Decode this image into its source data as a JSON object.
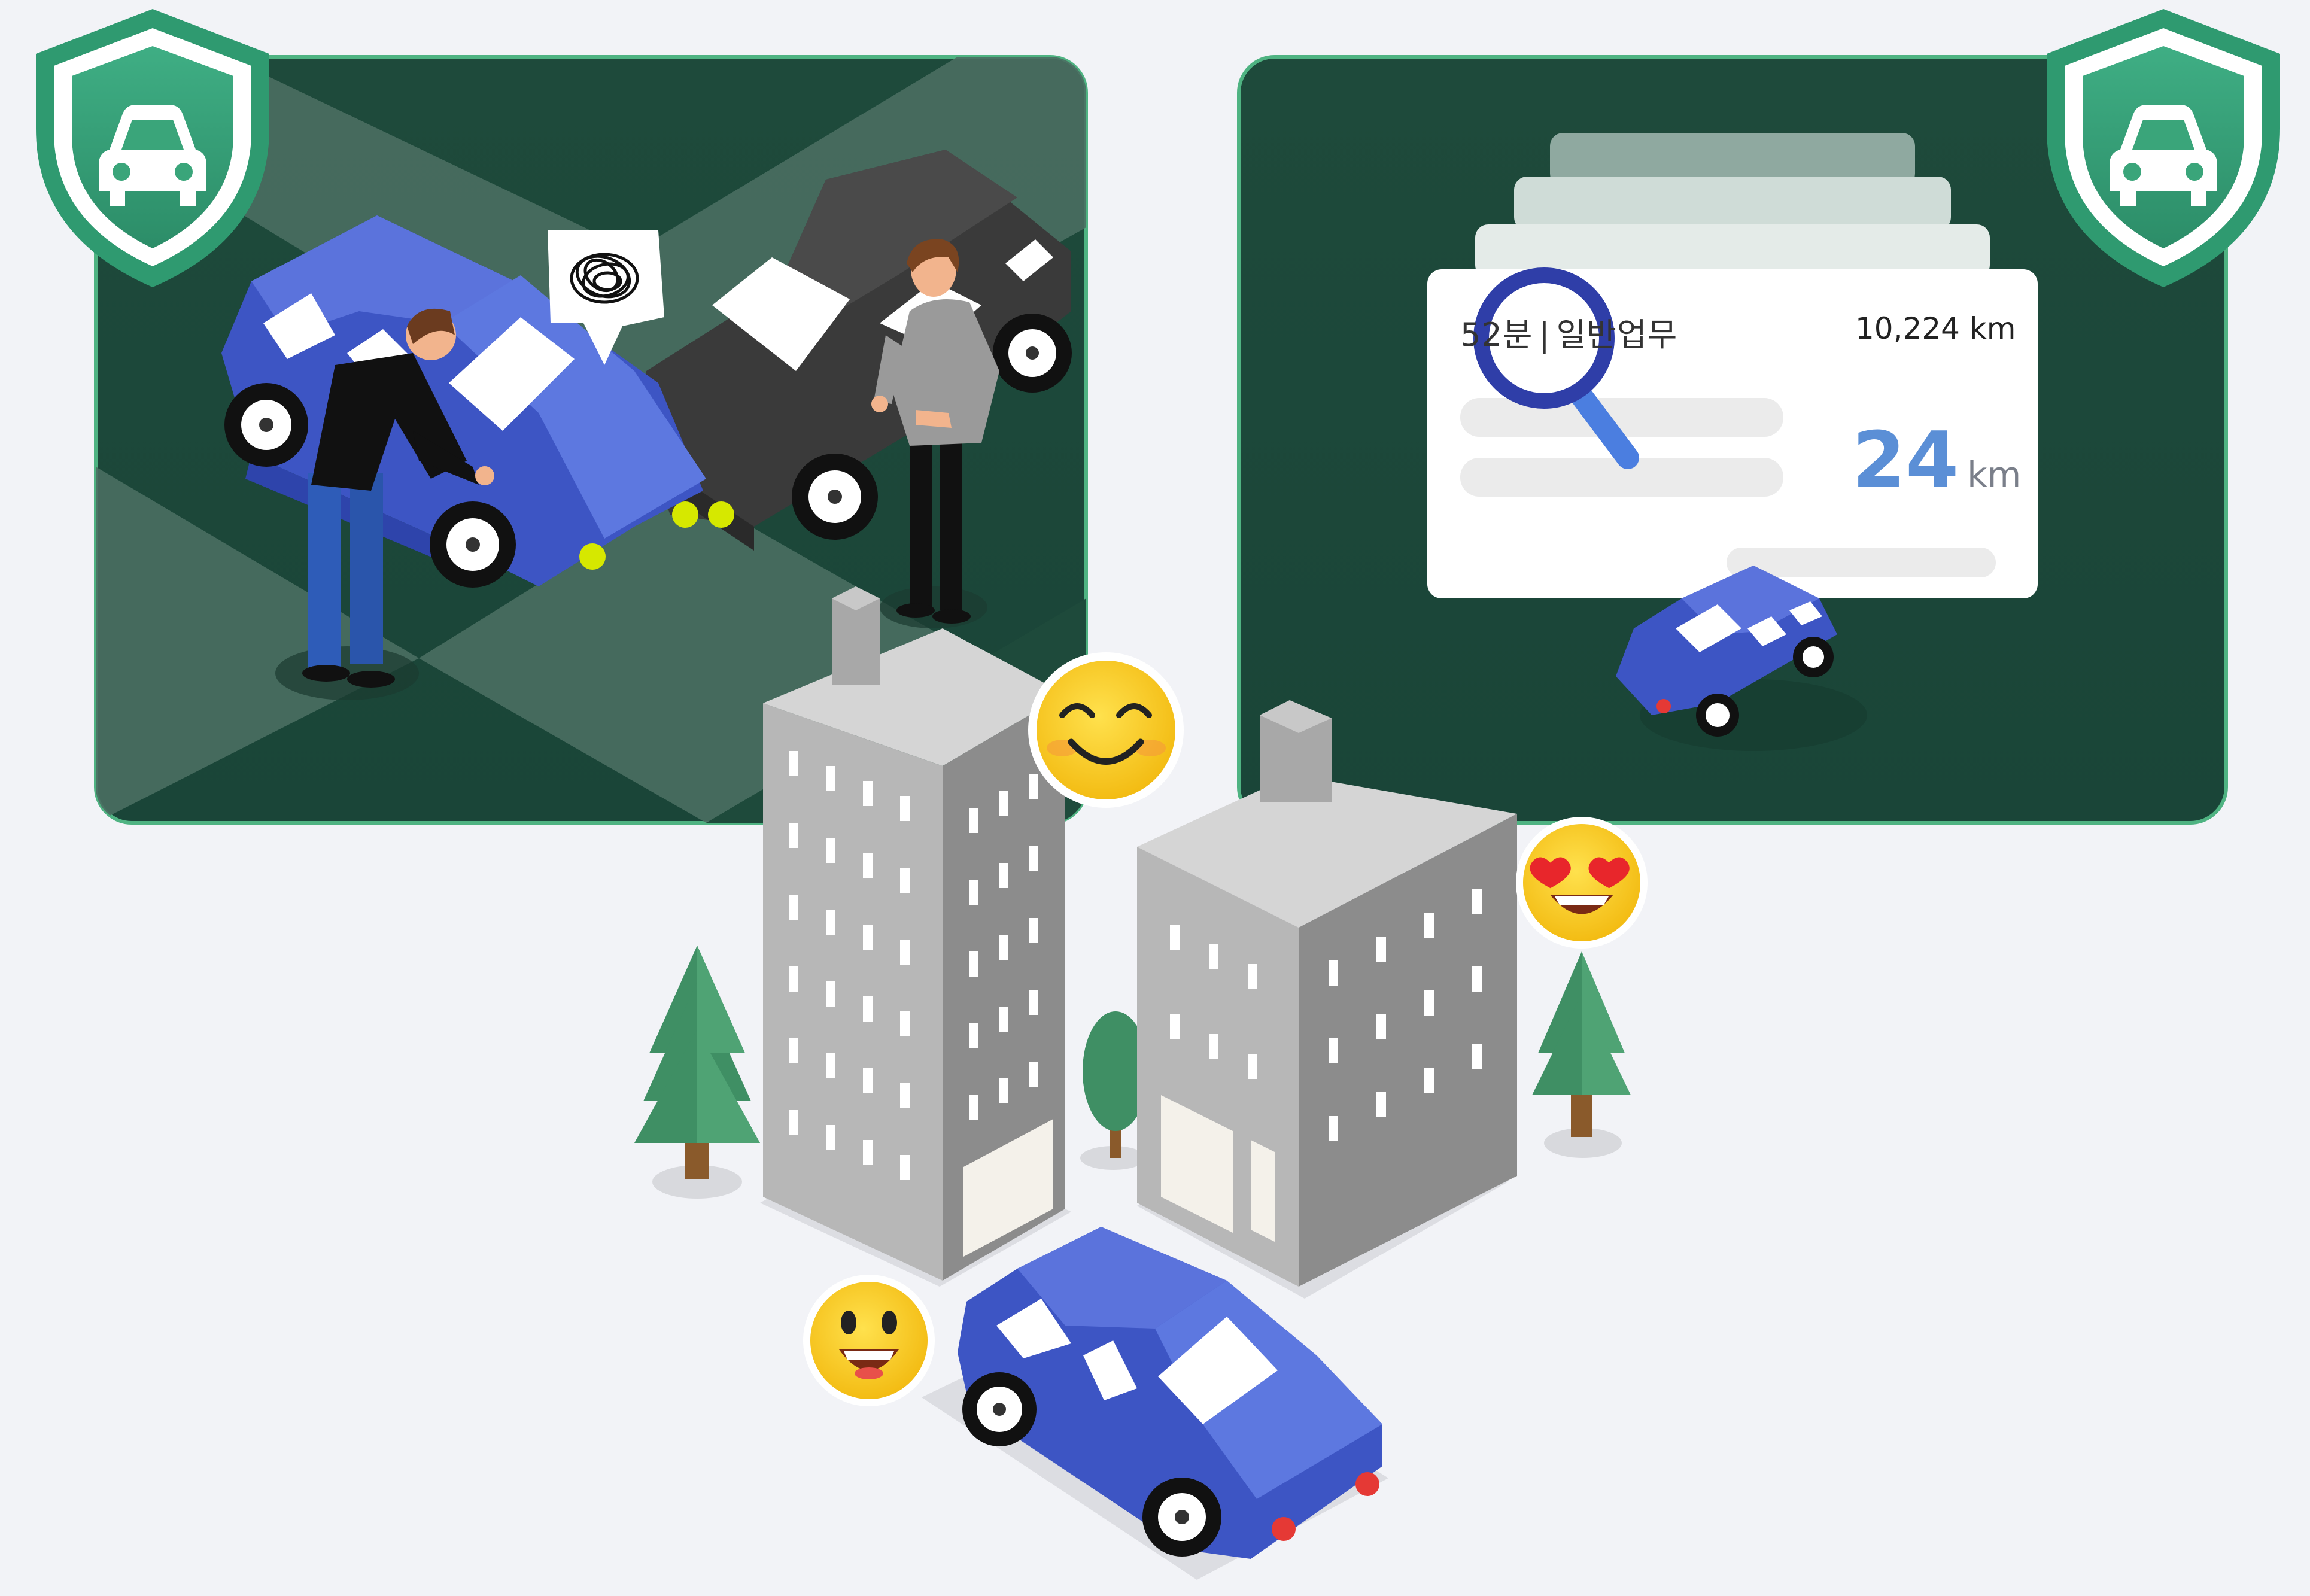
{
  "trip_card": {
    "duration": "52분",
    "separator": "|",
    "purpose": "일반업무",
    "odometer": "10,224 km",
    "distance_value": "24",
    "distance_unit": "km"
  },
  "icons": {
    "shield_left": "car-shield-icon",
    "shield_right": "car-shield-icon",
    "magnifier": "magnifier-icon",
    "emoji_top": "smiling-face-icon",
    "emoji_right": "heart-eyes-face-icon",
    "emoji_bottom": "grinning-face-icon"
  },
  "colors": {
    "background": "#f2f3f7",
    "panel_dark_green": "#1f4a3c",
    "shield_green": "#3aa57a",
    "car_blue": "#3d55c4",
    "accent_blue": "#5b8fd6"
  }
}
